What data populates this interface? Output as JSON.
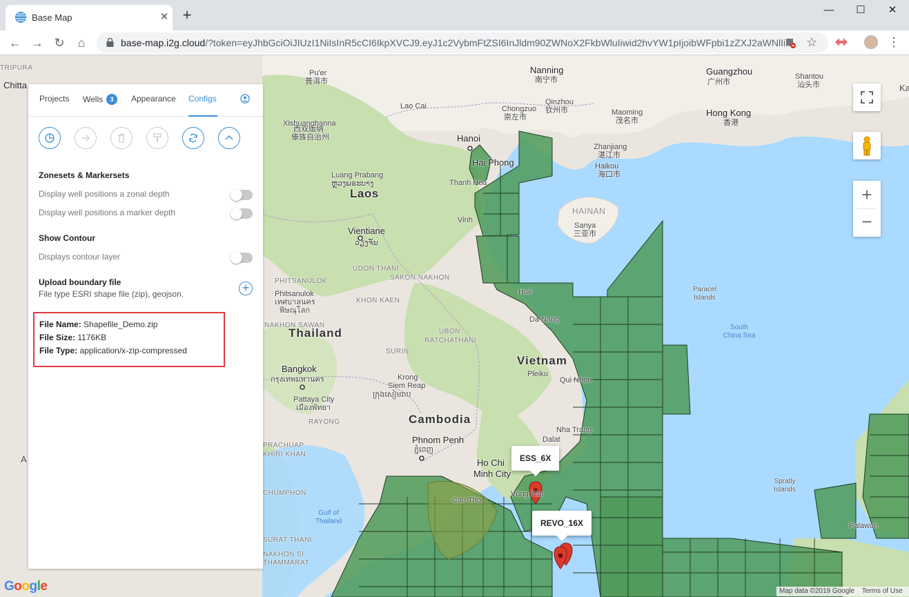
{
  "browser": {
    "tab_title": "Base Map",
    "tab_close": "✕",
    "new_tab": "+",
    "url_host": "base-map.i2g.cloud",
    "url_rest": "/?token=eyJhbGciOiJIUzI1NiIsInR5cCI6IkpXVCJ9.eyJ1c2VybmFtZSI6InJldm90ZWNoX2FkbWluIiwid2hvYW1pIjoibWFpbi1zZXJ2aWNlIi...",
    "window_controls": {
      "minimize": "—",
      "maximize": "☐",
      "close": "✕"
    },
    "nav": {
      "back": "←",
      "forward": "→",
      "reload": "↻",
      "home": "⌂"
    },
    "star": "☆",
    "menu": "⋮"
  },
  "panel": {
    "tabs": [
      {
        "label": "Projects",
        "active": false
      },
      {
        "label": "Wells",
        "active": false,
        "badge": "3"
      },
      {
        "label": "Appearance",
        "active": false
      },
      {
        "label": "Configs",
        "active": true
      }
    ],
    "toolbar_icons": [
      "pie-chart-icon",
      "arrow-right-icon",
      "trash-icon",
      "paint-roller-icon",
      "refresh-icon",
      "chevron-up-icon"
    ],
    "zonesets": {
      "title": "Zonesets & Markersets",
      "zonal_label": "Display well positions a zonal depth",
      "zonal_enabled": false,
      "marker_label": "Display well positions a marker depth",
      "marker_enabled": false
    },
    "contour": {
      "title": "Show Contour",
      "layer_label": "Displays contour layer",
      "layer_enabled": false
    },
    "upload": {
      "title": "Upload boundary file",
      "subtitle": "File type ESRI shape file (zip), geojson.",
      "button": "+"
    },
    "file_info": {
      "name_label": "File Name:",
      "name": "Shapefile_Demo.zip",
      "size_label": "File Size:",
      "size": "1176KB",
      "type_label": "File Type:",
      "type": "application/x-zip-compressed"
    }
  },
  "map": {
    "labels": {
      "tripura": "TRIPURA",
      "chitta": "Chitta",
      "nanning": "Nanning",
      "nanning_cn": "南宁市",
      "guangzhou": "Guangzhou",
      "guangzhou_cn": "广州市",
      "shantou": "Shantou",
      "shantou_cn": "汕头市",
      "puer": "Pu'er",
      "puer_cn": "普洱市",
      "laocai": "Lao Cai",
      "chongzuo": "Chongzuo",
      "chongzuo_cn": "崇左市",
      "qinzhou": "Qinzhou",
      "qinzhou_cn": "钦州市",
      "maoming": "Maoming",
      "maoming_cn": "茂名市",
      "hongkong": "Hong Kong",
      "hongkong_cn": "香港",
      "xishuangbanna": "Xishuangbanna",
      "xishuangbanna_cn1": "西双版纳",
      "xishuangbanna_cn2": "傣族自治州",
      "hanoi": "Hanoi",
      "haiphong": "Hai Phong",
      "zhanjiang": "Zhanjiang",
      "zhanjiang_cn": "湛江市",
      "haikou": "Haikou",
      "haikou_cn": "海口市",
      "luang": "Luang Prabang",
      "luang_lo": "ຫຼວງພຣະບາງ",
      "thanhhoa": "Thanh Hoa",
      "laos": "Laos",
      "hainan": "HAINAN",
      "sanya": "Sanya",
      "sanya_cn": "三亚市",
      "vinh": "Vinh",
      "vientiane": "Vientiane",
      "vientiane_lo": "ວຽງຈັນ",
      "udonthani": "UDON THANI",
      "sakonnakhon": "SAKON NAKHON",
      "phitsanulok": "PHITSANULOK",
      "phitsanulok_city": "Phitsanulok",
      "phitsanulok_th": "เทศบาลนคร",
      "phitsanulok_th2": "พิษณุโลก",
      "khonkaen": "KHON KAEN",
      "hue": "Huế",
      "paracel": "Paracel",
      "islands": "Islands",
      "nakhonsawan": "NAKHON SAWAN",
      "danang": "Da Nang",
      "southchinasea1": "South",
      "southchinasea2": "China Sea",
      "thailand": "Thailand",
      "ubon1": "UBON",
      "ubon2": "RATCHATHANI",
      "surin": "SURIN",
      "vietnam": "Vietnam",
      "bangkok": "Bangkok",
      "bangkok_th": "กรุงเทพมหานคร",
      "kronsiem1": "Krong",
      "kronsiem2": "Siem Reap",
      "kronsiem_km": "ក្រុងសៀមរាប",
      "pleiku": "Pleiku",
      "quinhon": "Qui Nhon",
      "pattaya": "Pattaya City",
      "pattaya_th": "เมืองพัทยา",
      "rayong": "RAYONG",
      "cambodia": "Cambodia",
      "nhatrang": "Nha Trang",
      "phnompenh": "Phnom Penh",
      "phnompenh_km": "ភ្នំពេញ",
      "dalat": "Dalat",
      "prachuap1": "PRACHUAP",
      "prachuap2": "KHIRI KHAN",
      "hochiminh1": "Ho Chi",
      "hochiminh2": "Minh City",
      "chumphon": "CHUMPHON",
      "vungtau": "Vũng Tàu",
      "cantho": "Can Tho",
      "gulf1": "Gulf of",
      "gulf2": "Thailand",
      "spratly1": "Spratly",
      "spratly2": "Islands",
      "suratthani1": "SURAT THANI",
      "suratthani2": "NAKHON SI",
      "suratthani3": "THAMMARAT",
      "palawan": "Palawan",
      "ka": "Ka",
      "a": "A"
    },
    "wells": [
      {
        "name": "ESS_6X"
      },
      {
        "name": "REVO_16X"
      }
    ],
    "controls": {
      "zoom_in": "+",
      "zoom_out": "−"
    },
    "google": [
      "G",
      "o",
      "o",
      "g",
      "l",
      "e"
    ],
    "google_colors": [
      "#4285f4",
      "#ea4335",
      "#fbbc05",
      "#4285f4",
      "#34a853",
      "#ea4335"
    ],
    "attribution": "Map data ©2019 Google",
    "terms": "Terms of Use"
  },
  "colors": {
    "accent": "#3a8ed9",
    "highlight_border": "#e0393e",
    "block_fill": "#4f9a59",
    "marker": "#d93a2b",
    "water": "#aadaff"
  }
}
